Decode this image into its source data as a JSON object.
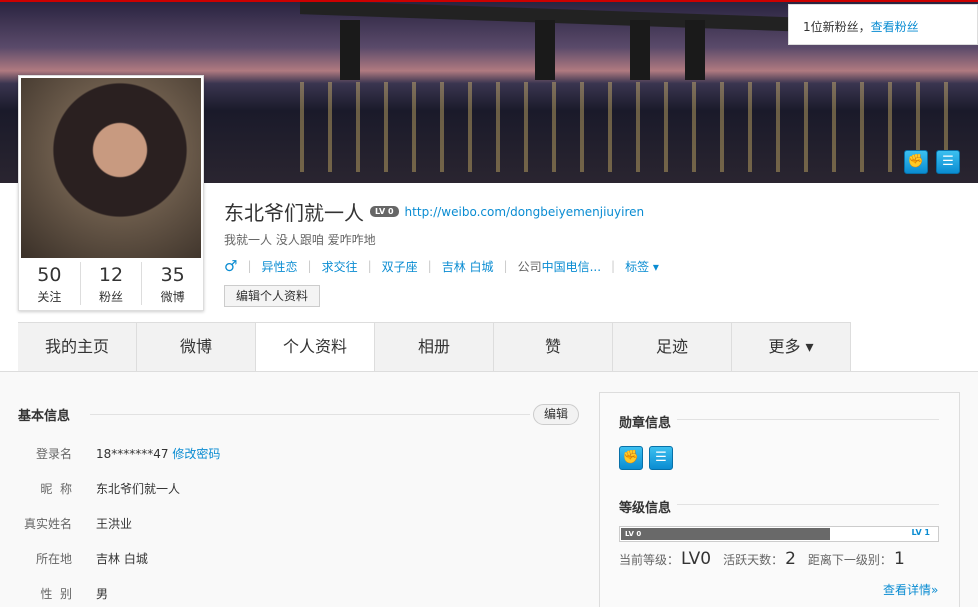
{
  "notify": {
    "text": "1位新粉丝，",
    "link": "查看粉丝"
  },
  "profile": {
    "name": "东北爷们就一人",
    "level": "LV 0",
    "url": "http://weibo.com/dongbeiyemenjiuyiren",
    "bio": "我就一人 没人跟咱 爱咋咋地",
    "gender_icon": "♂",
    "tags": [
      "异性恋",
      "求交往",
      "双子座",
      "吉林 白城"
    ],
    "company_label": "公司",
    "company": "中国电信...",
    "tag_menu": "标签",
    "edit_button": "编辑个人资料"
  },
  "stats": [
    {
      "n": "50",
      "l": "关注"
    },
    {
      "n": "12",
      "l": "粉丝"
    },
    {
      "n": "35",
      "l": "微博"
    }
  ],
  "tabs": [
    "我的主页",
    "微博",
    "个人资料",
    "相册",
    "赞",
    "足迹",
    "更多 ▾"
  ],
  "basic": {
    "title": "基本信息",
    "edit": "编辑",
    "rows": [
      {
        "k": "登录名",
        "v": "18*******47",
        "link": "修改密码"
      },
      {
        "k": "昵  称",
        "v": "东北爷们就一人"
      },
      {
        "k": "真实姓名",
        "v": "王洪业"
      },
      {
        "k": "所在地",
        "v": "吉林 白城"
      },
      {
        "k": "性  别",
        "v": "男"
      }
    ]
  },
  "medals": {
    "title": "勋章信息"
  },
  "level": {
    "title": "等级信息",
    "bar_left": "LV 0",
    "bar_right": "LV 1",
    "progress": 0.66,
    "current_label": "当前等级：",
    "current": "LV0",
    "days_label": "活跃天数：",
    "days": "2",
    "next_label": "距离下一级别：",
    "next": "1",
    "details": "查看详情»"
  }
}
